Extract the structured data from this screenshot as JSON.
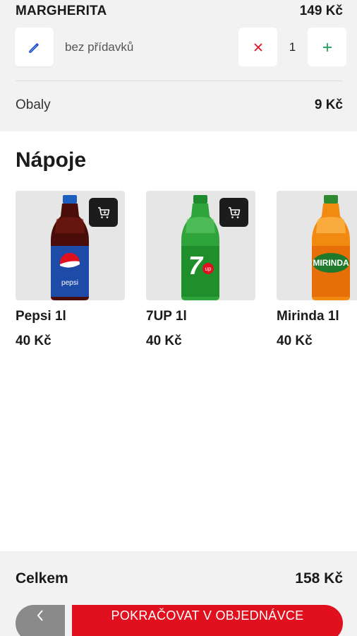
{
  "order_item": {
    "name": "MARGHERITA",
    "price": "149 Kč",
    "addons": "bez přídavků",
    "quantity": "1",
    "edit_icon": "pencil-icon",
    "minus_icon": "close-icon",
    "plus_icon": "plus-icon"
  },
  "packaging": {
    "label": "Obaly",
    "price": "9 Kč"
  },
  "drinks": {
    "title": "Nápoje",
    "products": [
      {
        "name": "Pepsi 1l",
        "price": "40 Kč",
        "icon": "cart-icon"
      },
      {
        "name": "7UP 1l",
        "price": "40 Kč",
        "icon": "cart-icon"
      },
      {
        "name": "Mirinda 1l",
        "price": "40 Kč"
      }
    ]
  },
  "footer": {
    "total_label": "Celkem",
    "total_value": "158 Kč",
    "back_icon": "chevron-left-icon",
    "continue_label": "POKRAČOVAT V OBJEDNÁVCE"
  },
  "colors": {
    "accent": "#e0101e",
    "minus": "#e0101e",
    "plus": "#1f9d55",
    "edit": "#1f4fd1"
  }
}
